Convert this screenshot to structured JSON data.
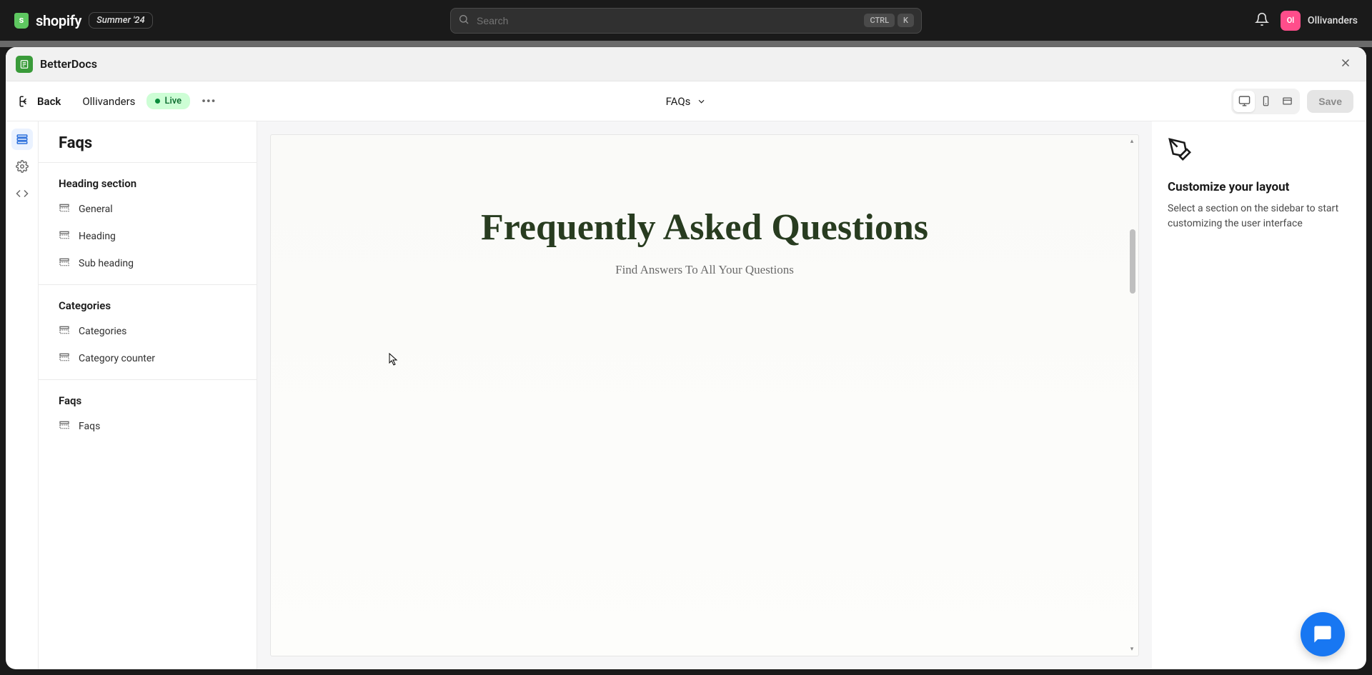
{
  "header": {
    "brand": "shopify",
    "badge": "Summer '24",
    "search_placeholder": "Search",
    "kbd1": "CTRL",
    "kbd2": "K",
    "user_initials": "Ol",
    "user_name": "Ollivanders"
  },
  "app": {
    "title": "BetterDocs"
  },
  "editor": {
    "back": "Back",
    "store": "Ollivanders",
    "status": "Live",
    "page": "FAQs",
    "save": "Save"
  },
  "sidebar": {
    "title": "Faqs",
    "groups": [
      {
        "header": "Heading section",
        "items": [
          "General",
          "Heading",
          "Sub heading"
        ]
      },
      {
        "header": "Categories",
        "items": [
          "Categories",
          "Category counter"
        ]
      },
      {
        "header": "Faqs",
        "items": [
          "Faqs"
        ]
      }
    ]
  },
  "canvas": {
    "heading": "Frequently Asked Questions",
    "sub": "Find Answers To All Your Questions"
  },
  "right": {
    "title": "Customize your layout",
    "desc": "Select a section on the sidebar to start customizing the user interface"
  }
}
